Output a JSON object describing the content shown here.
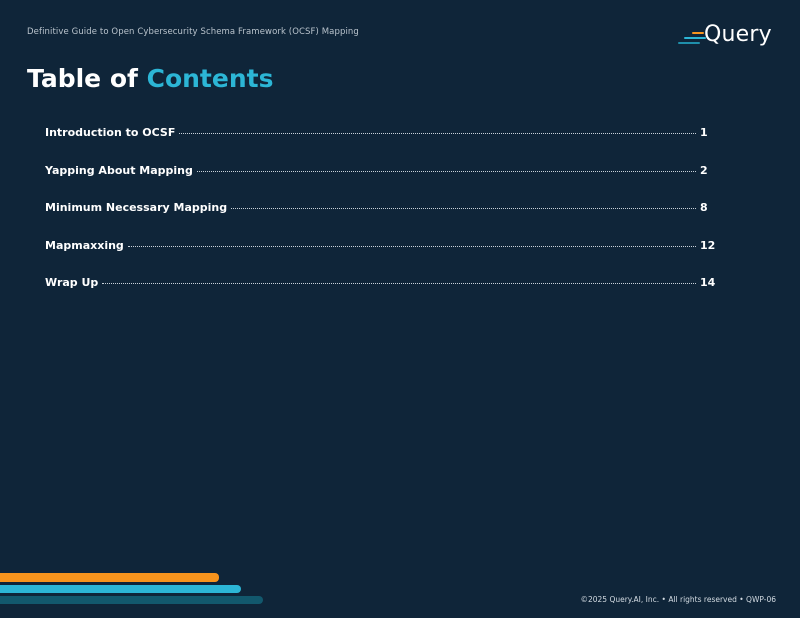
{
  "header": {
    "doc_title": "Definitive Guide to Open Cybersecurity Schema Framework (OCSF) Mapping",
    "logo_text": "Query"
  },
  "page": {
    "title_part1": "Table of",
    "title_part2": "Contents"
  },
  "toc": [
    {
      "title": "Introduction to OCSF",
      "page": "1"
    },
    {
      "title": "Yapping About Mapping",
      "page": "2"
    },
    {
      "title": "Minimum Necessary Mapping",
      "page": "8"
    },
    {
      "title": "Mapmaxxing",
      "page": "12"
    },
    {
      "title": "Wrap Up",
      "page": "14"
    }
  ],
  "footer": {
    "text": "©2025 Query.AI, Inc.  •  All rights reserved  •  QWP-06"
  },
  "colors": {
    "background": "#0f2539",
    "accent_cyan": "#2cb6d6",
    "accent_orange": "#f7941d",
    "accent_teal": "#12586d"
  }
}
